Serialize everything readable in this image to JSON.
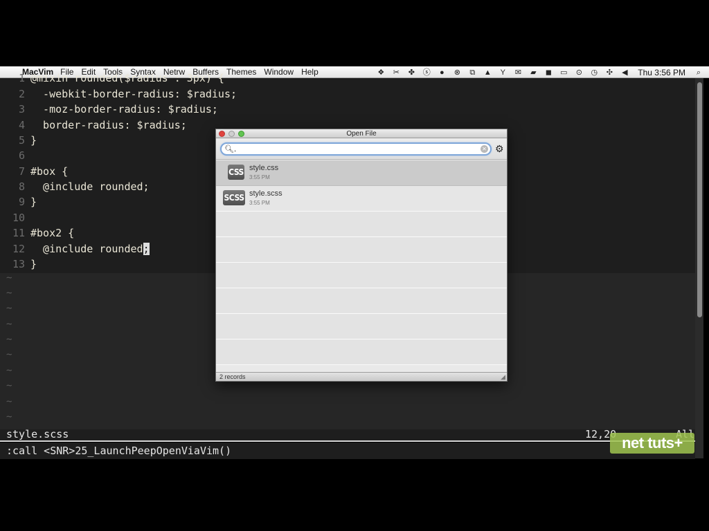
{
  "menubar": {
    "apple_glyph": "",
    "app_name": "MacVim",
    "items": [
      "File",
      "Edit",
      "Tools",
      "Syntax",
      "Netrw",
      "Buffers",
      "Themes",
      "Window",
      "Help"
    ],
    "clock": "Thu 3:56 PM"
  },
  "editor": {
    "lines": [
      {
        "num": "1",
        "text": "@mixin rounded($radius : 3px) {"
      },
      {
        "num": "2",
        "text": "  -webkit-border-radius: $radius;"
      },
      {
        "num": "3",
        "text": "  -moz-border-radius: $radius;"
      },
      {
        "num": "4",
        "text": "  border-radius: $radius;"
      },
      {
        "num": "5",
        "text": "}"
      },
      {
        "num": "6",
        "text": ""
      },
      {
        "num": "7",
        "text": "#box {"
      },
      {
        "num": "8",
        "text": "  @include rounded;"
      },
      {
        "num": "9",
        "text": "}"
      },
      {
        "num": "10",
        "text": ""
      },
      {
        "num": "11",
        "text": "#box2 {"
      },
      {
        "num": "12",
        "text": "  @include rounded",
        "cursor_char": ";"
      },
      {
        "num": "13",
        "text": "}"
      }
    ],
    "tilde": "~"
  },
  "statusline": {
    "filename": "style.scss",
    "position": "12,20",
    "percent": "All"
  },
  "cmdline": ":call <SNR>25_LaunchPeepOpenViaVim()",
  "watermark": "net tuts+",
  "open_file": {
    "title": "Open File",
    "search_value": ".",
    "results": [
      {
        "badge": "CSS",
        "name": "style.css",
        "time": "3:55 PM"
      },
      {
        "badge": "SCSS",
        "name": "style.scss",
        "time": "3:55 PM"
      }
    ],
    "footer": "2 records"
  }
}
